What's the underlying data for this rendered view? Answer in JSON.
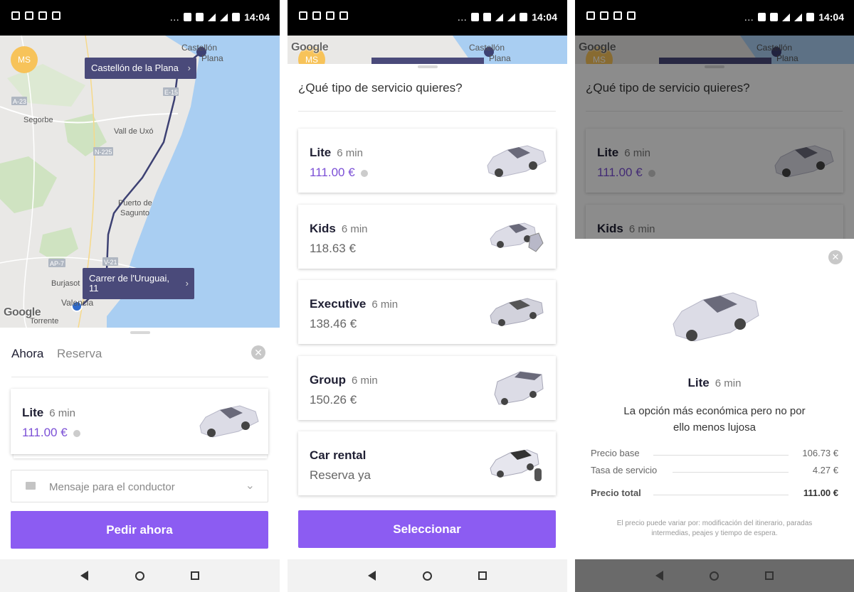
{
  "status": {
    "time": "14:04"
  },
  "colors": {
    "accent": "#8c5cf2",
    "price": "#7b4fd6",
    "callout": "#4a4a7a",
    "avatar": "#f7c35a"
  },
  "map": {
    "origin": "Castellón de la Plana",
    "destination": "Carrer de l'Uruguai, 11",
    "avatar": "MS",
    "google": "Google",
    "labels": {
      "castellon": "Castellón",
      "castellon_2": "Plana",
      "segorbe": "Segorbe",
      "vall": "Vall de Uxó",
      "puerto": "Puerto de",
      "sagunto": "Sagunto",
      "burjasot": "Burjasot",
      "valencia": "Valencia",
      "torrente": "Torrente",
      "a23": "A-23",
      "n225": "N-225",
      "e15": "E-15",
      "ap7": "AP-7",
      "v21": "V-21"
    }
  },
  "screen1": {
    "tab_now": "Ahora",
    "tab_reserve": "Reserva",
    "service": {
      "name": "Lite",
      "eta": "6 min",
      "price": "111.00 €"
    },
    "message_placeholder": "Mensaje para el conductor",
    "button": "Pedir ahora"
  },
  "screen2": {
    "question": "¿Qué tipo de servicio quieres?",
    "services": [
      {
        "name": "Lite",
        "eta": "6 min",
        "price": "111.00 €"
      },
      {
        "name": "Kids",
        "eta": "6 min",
        "price": "118.63 €"
      },
      {
        "name": "Executive",
        "eta": "6 min",
        "price": "138.46 €"
      },
      {
        "name": "Group",
        "eta": "6 min",
        "price": "150.26 €"
      },
      {
        "name": "Car rental",
        "eta": "",
        "price": "Reserva ya"
      }
    ],
    "button": "Seleccionar"
  },
  "screen3": {
    "question": "¿Qué tipo de servicio quieres?",
    "bg_services": [
      {
        "name": "Lite",
        "eta": "6 min",
        "price": "111.00 €"
      },
      {
        "name": "Kids",
        "eta": "6 min"
      }
    ],
    "modal": {
      "name": "Lite",
      "eta": "6 min",
      "description_1": "La opción más económica pero no por",
      "description_2": "ello menos lujosa",
      "rows": [
        {
          "label": "Precio base",
          "value": "106.73 €"
        },
        {
          "label": "Tasa de servicio",
          "value": "4.27 €"
        },
        {
          "label": "Precio total",
          "value": "111.00 €"
        }
      ],
      "note_1": "El precio puede variar por: modificación del itinerario, paradas",
      "note_2": "intermedias, peajes y tiempo de espera."
    }
  }
}
